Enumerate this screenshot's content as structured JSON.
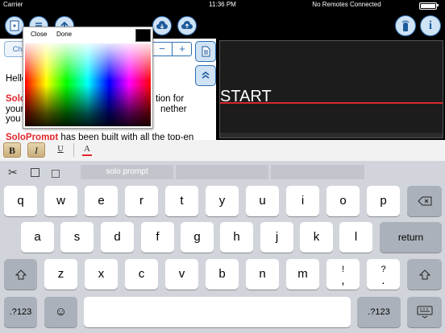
{
  "status_bar": {
    "carrier": "Carrier",
    "time": "11:36 PM",
    "remote_status": "No Remotes Connected"
  },
  "icons": {
    "new_document": "document-plus-icon",
    "list": "list-icon",
    "upload_top": "arrow-up-icon",
    "download_cloud": "cloud-download-icon",
    "upload_cloud": "cloud-upload-icon",
    "remote": "remote-control-icon",
    "info": "info-icon",
    "doc_side": "document-icon",
    "chevron_up": "chevron-up-icon"
  },
  "color_picker": {
    "close_label": "Close",
    "done_label": "Done",
    "selected_color": "#000000"
  },
  "editor": {
    "tab_label": "Cha",
    "stepper_minus": "−",
    "stepper_plus": "+",
    "lines": [
      "Hello",
      "Solo",
      "your",
      "you",
      "SoloPrompt has been built with all the top-end"
    ],
    "partial_right": [
      "tion for",
      "nether"
    ]
  },
  "preview": {
    "start_text": "START",
    "accent_color": "#d8262c"
  },
  "format_toolbar": {
    "bold": "B",
    "italic": "I",
    "underline": "U",
    "text_color": "A"
  },
  "keyboard": {
    "suggestions": [
      "solo prompt",
      "",
      ""
    ],
    "row1": [
      "q",
      "w",
      "e",
      "r",
      "t",
      "y",
      "u",
      "i",
      "o",
      "p"
    ],
    "row2": [
      "a",
      "s",
      "d",
      "f",
      "g",
      "h",
      "j",
      "k",
      "l"
    ],
    "row3": [
      "z",
      "x",
      "c",
      "v",
      "b",
      "n",
      "m"
    ],
    "punct1": [
      "!",
      ","
    ],
    "punct2": [
      "?",
      "."
    ],
    "return_label": "return",
    "numbers_label": ".?123"
  }
}
